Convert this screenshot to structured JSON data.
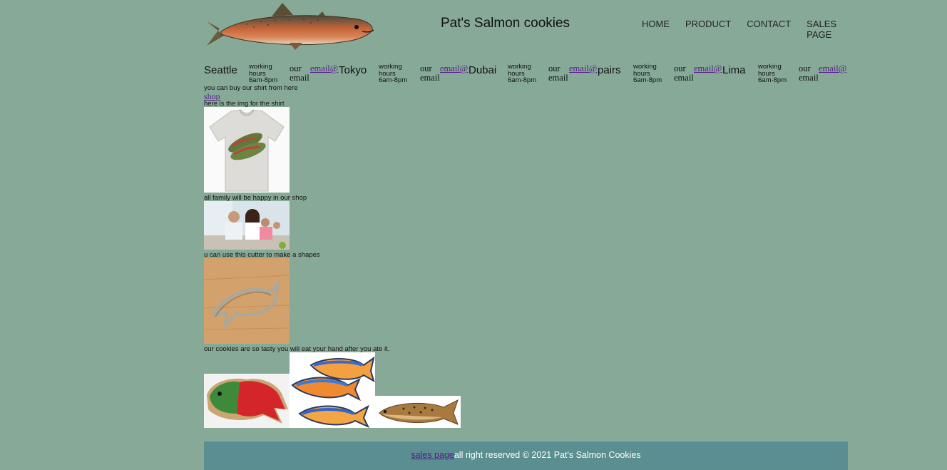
{
  "header": {
    "site_title": "Pat's Salmon cookies",
    "nav": [
      "HOME",
      "PRODUCT",
      "CONTACT",
      "SALES PAGE"
    ]
  },
  "locations": [
    {
      "city": "Seattle",
      "hours": "working hours 6am-8pm",
      "email_text": "our email",
      "email_link": "email@"
    },
    {
      "city": "Tokyo",
      "hours": "working hours 6am-8pm",
      "email_text": "our email",
      "email_link": "email@"
    },
    {
      "city": "Dubai",
      "hours": "working hours 6am-8pm",
      "email_text": "our email",
      "email_link": "email@"
    },
    {
      "city": "pairs",
      "hours": "working hours 6am-8pm",
      "email_text": "our email",
      "email_link": "email@"
    },
    {
      "city": "Lima",
      "hours": "working hours 6am-8pm",
      "email_text": "our email",
      "email_link": "email@"
    }
  ],
  "content": {
    "buy_text": "you can buy our shirt from here",
    "shop_link": "shop",
    "shirt_text": "here is the img for the shirt",
    "family_text": "all family will be happy in our shop",
    "cutter_text": "u can use this cutter to make a shapes",
    "cookies_text": "our cookies are so tasty you will eat your hand after you ate it."
  },
  "footer": {
    "sales_link": "sales page",
    "copyright": "all right reserved © 2021 Pat's Salmon Cookies"
  },
  "colors": {
    "background": "#87aa98",
    "footer": "#5a8e91",
    "link": "#551a8b"
  }
}
